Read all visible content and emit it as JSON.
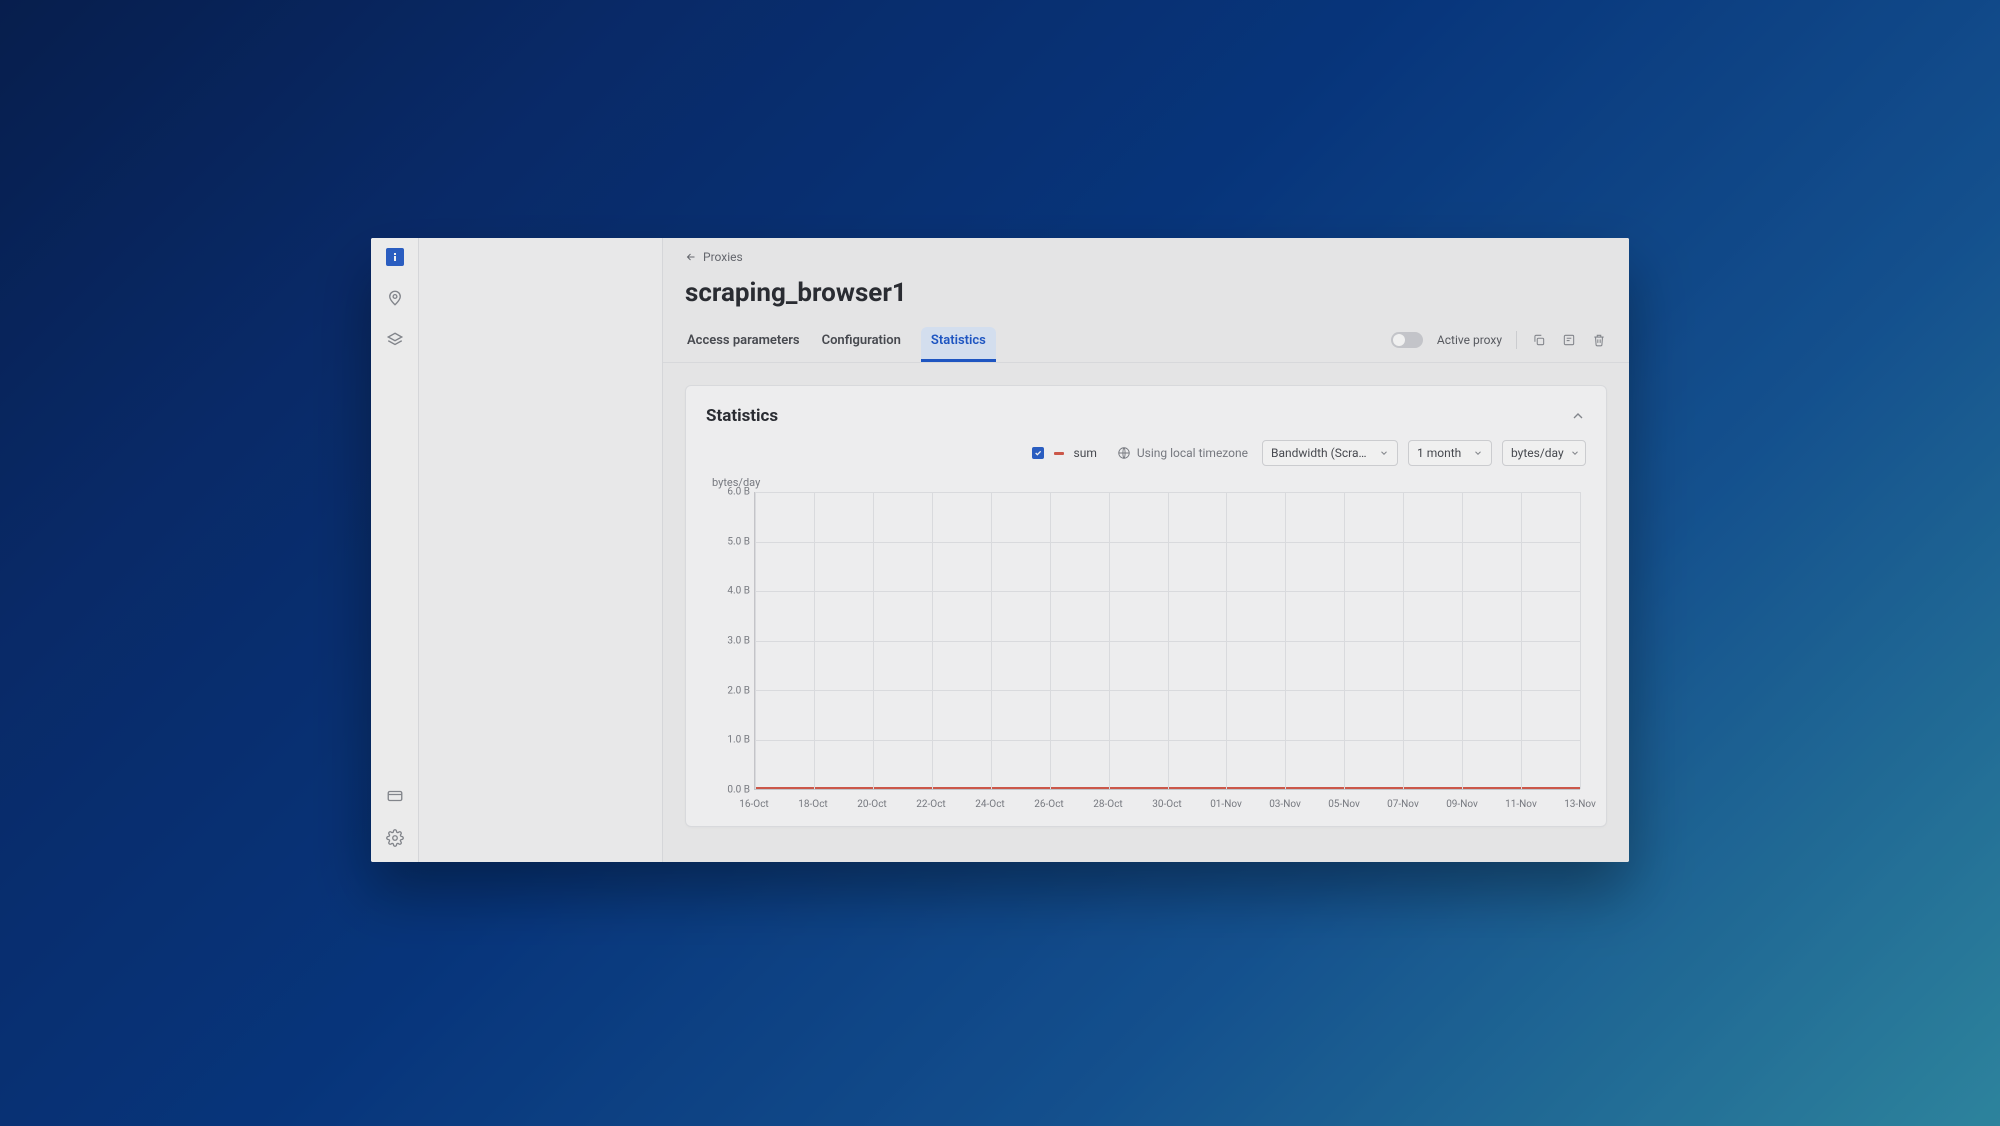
{
  "breadcrumb": {
    "back_label": "Proxies"
  },
  "page": {
    "title": "scraping_browser1"
  },
  "tabs": [
    {
      "label": "Access parameters",
      "active": false
    },
    {
      "label": "Configuration",
      "active": false
    },
    {
      "label": "Statistics",
      "active": true
    }
  ],
  "header_right": {
    "toggle_label": "Active proxy",
    "toggle_on": false
  },
  "card": {
    "title": "Statistics",
    "legend": {
      "sum_checked": true,
      "sum_label": "sum"
    },
    "timezone_label": "Using local timezone",
    "metric_select": "Bandwidth (Scraping Brows",
    "period_select": "1 month",
    "unit_select": "bytes/day"
  },
  "colors": {
    "accent": "#2863d6",
    "series_sum": "#e05a4a"
  },
  "chart_data": {
    "type": "line",
    "ylabel": "bytes/day",
    "xlabel": "",
    "ylim": [
      0,
      6
    ],
    "y_tick_suffix": " B",
    "y_ticks": [
      "0.0 B",
      "1.0 B",
      "2.0 B",
      "3.0 B",
      "4.0 B",
      "5.0 B",
      "6.0 B"
    ],
    "categories": [
      "16-Oct",
      "18-Oct",
      "20-Oct",
      "22-Oct",
      "24-Oct",
      "26-Oct",
      "28-Oct",
      "30-Oct",
      "01-Nov",
      "03-Nov",
      "05-Nov",
      "07-Nov",
      "09-Nov",
      "11-Nov",
      "13-Nov"
    ],
    "series": [
      {
        "name": "sum",
        "color": "#e05a4a",
        "values": [
          0,
          0,
          0,
          0,
          0,
          0,
          0,
          0,
          0,
          0,
          0,
          0,
          0,
          0,
          0
        ]
      }
    ]
  }
}
